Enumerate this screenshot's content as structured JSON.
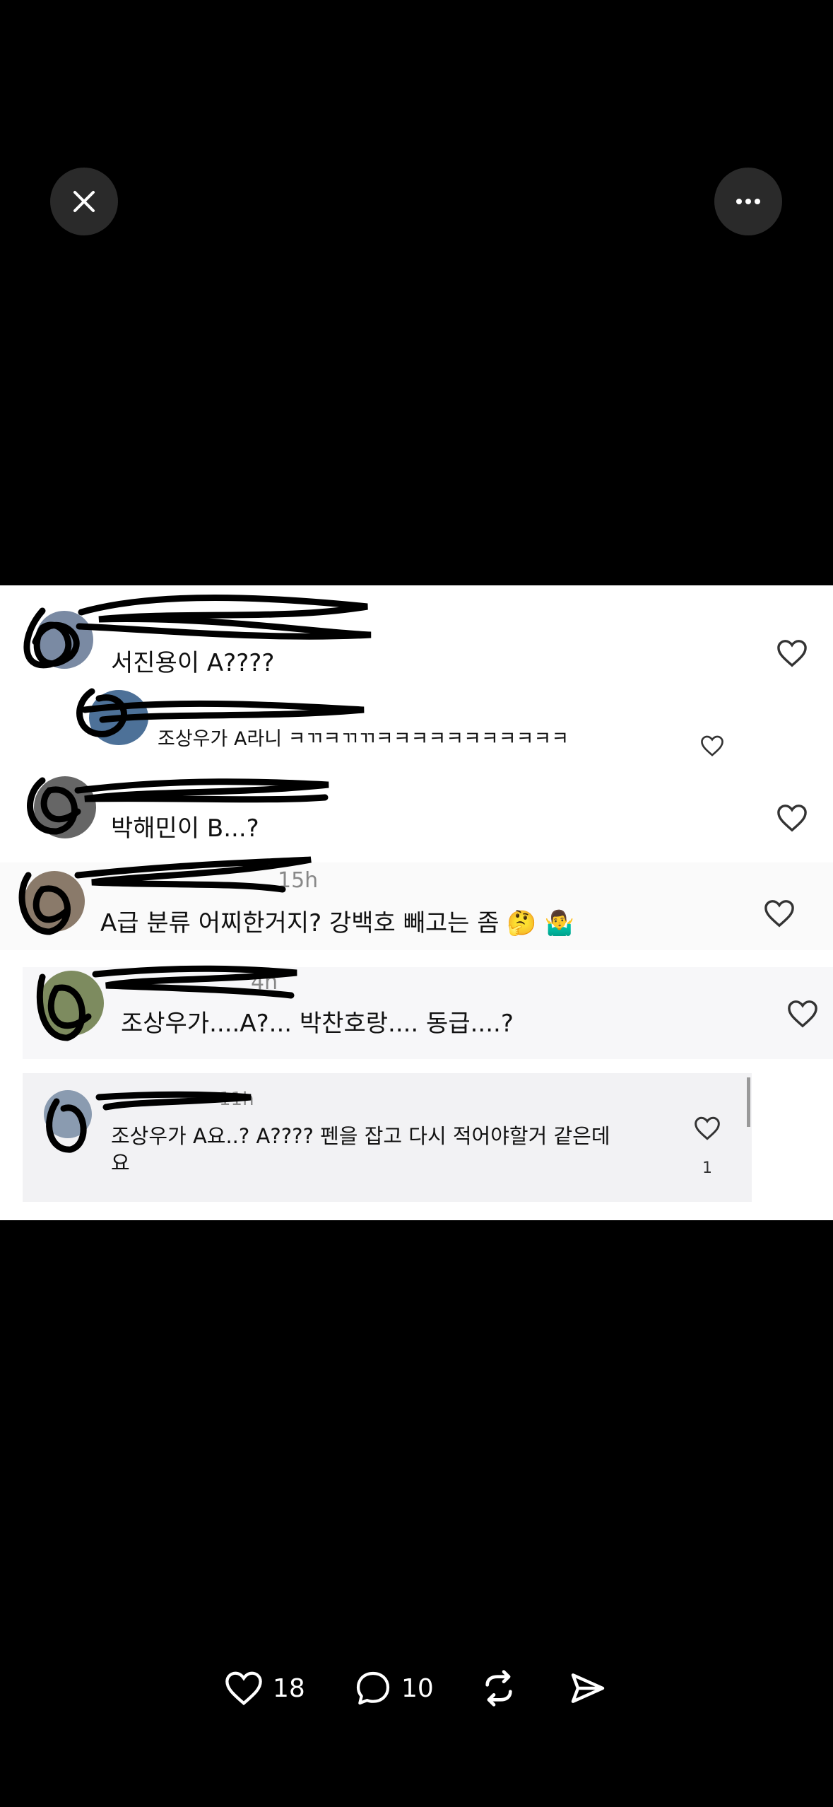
{
  "viewer": {
    "close_icon": "close-icon",
    "more_icon": "more-icon"
  },
  "comments": [
    {
      "text": "서진용이 A????",
      "time": "",
      "likes": ""
    },
    {
      "text": "조상우가 A라니 ㅋㄲㅋㄲㄲㅋㅋㅋㅋㅋㅋㅋㅋㅋㅋㅋ",
      "time": "",
      "likes": ""
    },
    {
      "text": "박해민이 B...?",
      "time": "",
      "likes": ""
    },
    {
      "text": "A급 분류 어찌한거지? 강백호 빼고는 좀 🤔 🤷‍♂️",
      "time": "15h",
      "likes": ""
    },
    {
      "text": "조상우가....A?... 박찬호랑.... 동급....?",
      "time": "4h",
      "likes": ""
    },
    {
      "text_line1": "조상우가 A요..? A???? 펜을 잡고 다시 적어야할거 같은데",
      "text_line2": "요",
      "time": "11h",
      "likes": "1"
    }
  ],
  "actions": {
    "like_count": "18",
    "comment_count": "10"
  }
}
